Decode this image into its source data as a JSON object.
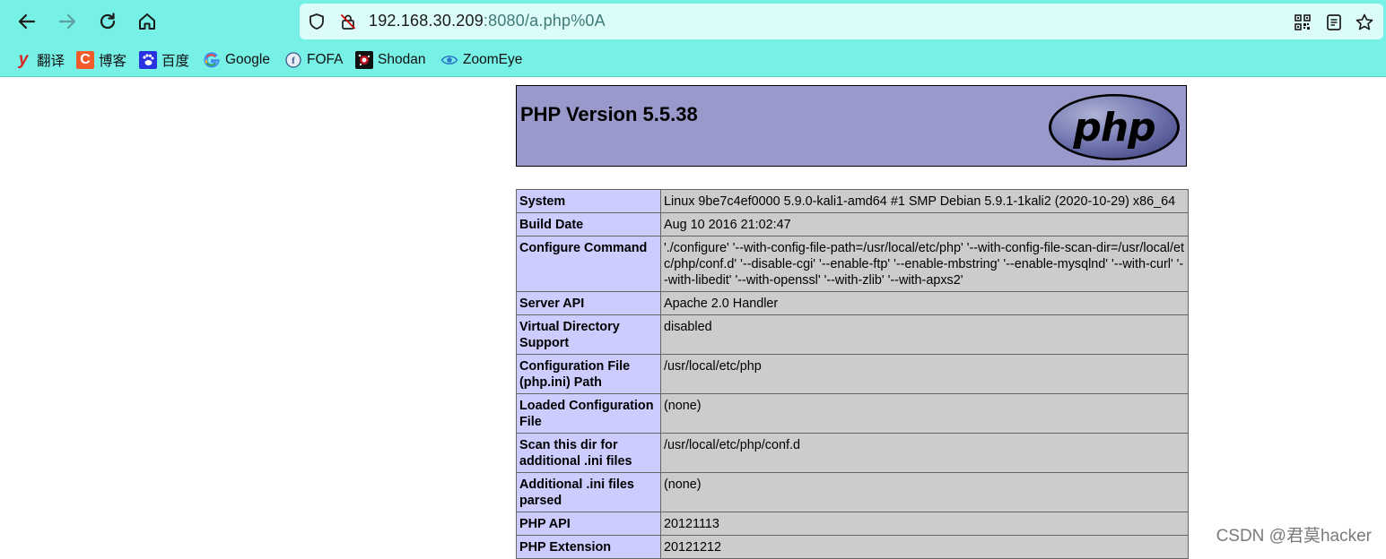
{
  "browser": {
    "url_host": "192.168.30.209",
    "url_rest": ":8080/a.php%0A",
    "bookmarks": [
      {
        "label": "翻译",
        "icon": "youdao-icon",
        "color": "#e02020"
      },
      {
        "label": "博客",
        "icon": "csdn-icon",
        "color": "#f25c2a"
      },
      {
        "label": "百度",
        "icon": "baidu-icon",
        "color": "#2932e1"
      },
      {
        "label": "Google",
        "icon": "google-icon",
        "color": "#4285f4"
      },
      {
        "label": "FOFA",
        "icon": "fofa-icon",
        "color": "#3a5a8a"
      },
      {
        "label": "Shodan",
        "icon": "shodan-icon",
        "color": "#b0101a"
      },
      {
        "label": "ZoomEye",
        "icon": "zoomeye-icon",
        "color": "#2a78c8"
      }
    ]
  },
  "php": {
    "title": "PHP Version 5.5.38",
    "logo_text": "php",
    "rows": [
      {
        "key": "System",
        "value": "Linux 9be7c4ef0000 5.9.0-kali1-amd64 #1 SMP Debian 5.9.1-1kali2 (2020-10-29) x86_64"
      },
      {
        "key": "Build Date",
        "value": "Aug 10 2016 21:02:47"
      },
      {
        "key": "Configure Command",
        "value": "'./configure' '--with-config-file-path=/usr/local/etc/php' '--with-config-file-scan-dir=/usr/local/etc/php/conf.d' '--disable-cgi' '--enable-ftp' '--enable-mbstring' '--enable-mysqlnd' '--with-curl' '--with-libedit' '--with-openssl' '--with-zlib' '--with-apxs2'"
      },
      {
        "key": "Server API",
        "value": "Apache 2.0 Handler"
      },
      {
        "key": "Virtual Directory Support",
        "value": "disabled"
      },
      {
        "key": "Configuration File (php.ini) Path",
        "value": "/usr/local/etc/php"
      },
      {
        "key": "Loaded Configuration File",
        "value": "(none)"
      },
      {
        "key": "Scan this dir for additional .ini files",
        "value": "/usr/local/etc/php/conf.d"
      },
      {
        "key": "Additional .ini files parsed",
        "value": "(none)"
      },
      {
        "key": "PHP API",
        "value": "20121113"
      },
      {
        "key": "PHP Extension",
        "value": "20121212"
      }
    ]
  },
  "watermark": "CSDN @君莫hacker",
  "colors": {
    "chrome_bg": "#77f0e6",
    "header_bg": "#9999cc",
    "key_bg": "#ccccff",
    "value_bg": "#cccccc"
  }
}
